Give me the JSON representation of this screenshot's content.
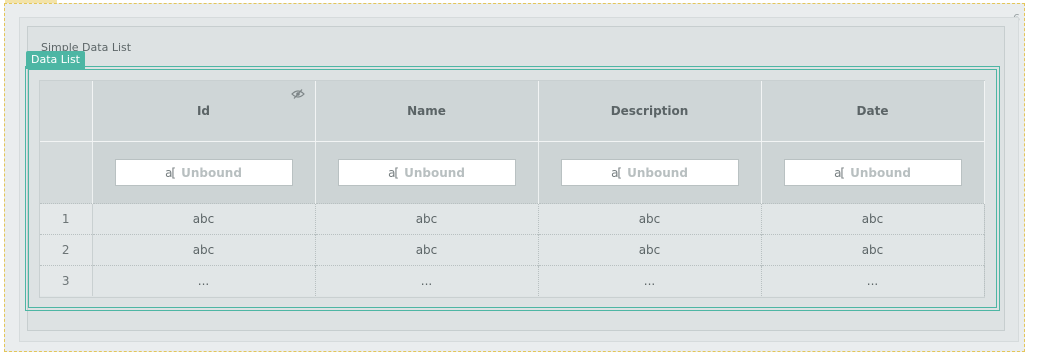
{
  "frame": {
    "number": "6"
  },
  "panel": {
    "title": "Simple Data List",
    "badge": "Data List"
  },
  "grid": {
    "columns": [
      {
        "label": "Id",
        "visibility_icon": "eye-slash-icon"
      },
      {
        "label": "Name"
      },
      {
        "label": "Description"
      },
      {
        "label": "Date"
      }
    ],
    "filter": {
      "icon": "text-cursor-icon",
      "placeholder": "Unbound"
    },
    "rows": [
      {
        "index": "1",
        "cells": [
          "abc",
          "abc",
          "abc",
          "abc"
        ]
      },
      {
        "index": "2",
        "cells": [
          "abc",
          "abc",
          "abc",
          "abc"
        ]
      },
      {
        "index": "3",
        "cells": [
          "...",
          "...",
          "...",
          "..."
        ]
      }
    ]
  },
  "colors": {
    "accent": "#4db6a4",
    "dashed_border": "#e4c659"
  }
}
